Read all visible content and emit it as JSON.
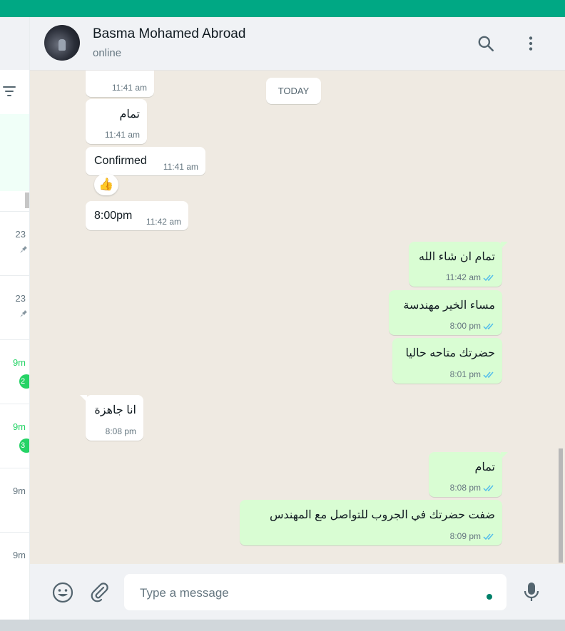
{
  "colors": {
    "accent": "#00a884",
    "outgoing_bubble": "#d9fdd3",
    "incoming_bubble": "#ffffff",
    "chat_bg": "#efeae2",
    "read_ticks": "#53bdeb",
    "unread_badge": "#25d366"
  },
  "chat_list": {
    "rows": [
      {
        "time": "23",
        "pinned": true
      },
      {
        "time": "23",
        "pinned": true
      },
      {
        "time": "9m",
        "badge": "2"
      },
      {
        "time": "9m",
        "badge": "3"
      },
      {
        "time": "9m"
      },
      {
        "time": "9m"
      }
    ]
  },
  "header": {
    "contact_name": "Basma Mohamed Abroad",
    "status": "online",
    "icons": [
      "search-icon",
      "menu-icon"
    ]
  },
  "messages": {
    "date_divider": "TODAY",
    "partial_top": {
      "time": "11:41 am"
    },
    "items": [
      {
        "dir": "in",
        "text": "تمام",
        "time": "11:41 am"
      },
      {
        "dir": "in",
        "text": "Confirmed",
        "time": "11:41 am",
        "reaction": "👍"
      },
      {
        "dir": "in",
        "text": "8:00pm",
        "time": "11:42 am"
      },
      {
        "dir": "out",
        "text": "تمام ان شاء الله",
        "time": "11:42 am"
      },
      {
        "dir": "out",
        "text": "مساء الخير مهندسة",
        "time": "8:00 pm"
      },
      {
        "dir": "out",
        "text": "حضرتك متاحه حاليا",
        "time": "8:01 pm"
      },
      {
        "dir": "in",
        "text": "انا جاهزة",
        "time": "8:08 pm"
      },
      {
        "dir": "out",
        "text": "تمام",
        "time": "8:08 pm"
      },
      {
        "dir": "out",
        "text": "ضفت حضرتك في الجروب للتواصل مع المهندس",
        "time": "8:09 pm"
      }
    ]
  },
  "composer": {
    "placeholder": "Type a message",
    "icons": [
      "emoji-icon",
      "attach-icon",
      "mic-icon"
    ]
  }
}
